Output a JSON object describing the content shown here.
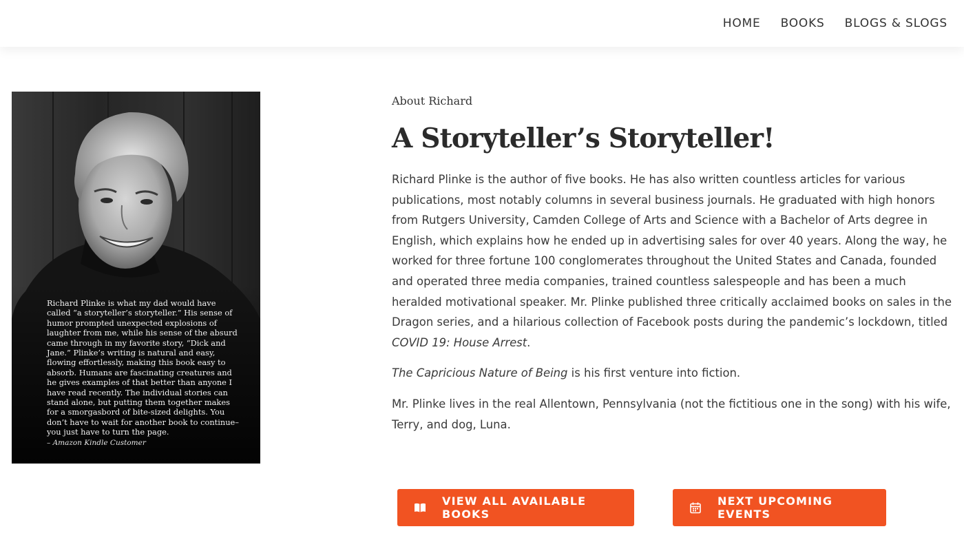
{
  "nav": {
    "items": [
      "HOME",
      "BOOKS",
      "BLOGS & SLOGS"
    ]
  },
  "photo": {
    "quote": "Richard Plinke is what my dad would have called “a storyteller’s storyteller.” His sense of humor prompted unexpected explosions of laughter from me, while his sense of the absurd came through in my favorite story, “Dick and Jane.” Plinke’s writing is natural and easy, flowing effortlessly, making this book easy to absorb. Humans are fascinating creatures and he gives examples of that better than anyone I have read recently. The individual stories can stand alone, but putting them together makes for a smorgasbord of bite-sized delights. You don’t have to wait for another book to continue–you just have to turn the page.",
    "attribution": "– Amazon Kindle Customer"
  },
  "about": {
    "eyebrow": "About Richard",
    "title": "A Storyteller’s Storyteller!",
    "para1_text": "Richard Plinke is the author of five books. He has also written countless articles for various publications, most notably columns in several business journals. He graduated with high honors from Rutgers University, Camden College of Arts and Science with a Bachelor of Arts degree in English, which explains how he ended up in advertising sales for over 40 years. Along the way, he worked for three fortune 100 conglomerates throughout the United  States and Canada, founded and operated three media companies, trained countless salespeople and has been a much heralded motivational speaker. Mr. Plinke published three critically acclaimed books on sales in the Dragon series, and a hilarious collection of Facebook posts during the pandemic’s lockdown, titled ",
    "para1_italic": "COVID 19: House Arrest",
    "para1_end": ".",
    "para2_italic": "The Capricious Nature of Being",
    "para2_text": " is his first venture into fiction.",
    "para3_text": "Mr. Plinke lives in the real Allentown, Pennsylvania (not the fictitious one in the song) with his wife, Terry, and dog, Luna."
  },
  "buttons": {
    "books_label": "VIEW ALL AVAILABLE BOOKS",
    "events_label": "NEXT UPCOMING EVENTS"
  },
  "icons": {
    "books": "open-book-icon",
    "events": "calendar-icon"
  },
  "colors": {
    "accent": "#f15322",
    "text": "#3a3a3a",
    "photo_bg": "#0b0b0b"
  }
}
